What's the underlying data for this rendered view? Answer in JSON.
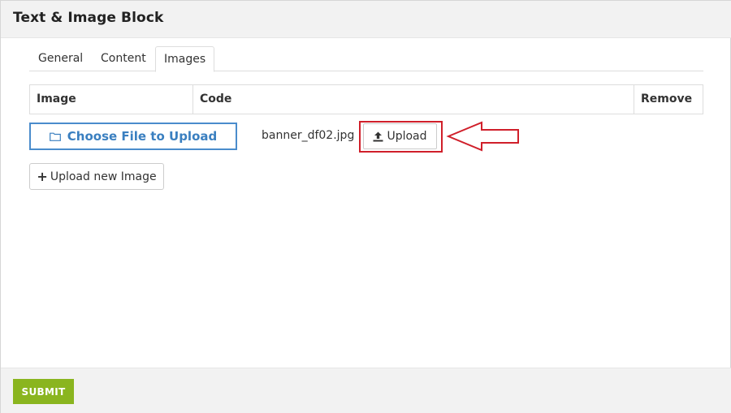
{
  "header": {
    "title": "Text & Image Block"
  },
  "tabs": [
    {
      "label": "General"
    },
    {
      "label": "Content"
    },
    {
      "label": "Images",
      "active": true
    }
  ],
  "table": {
    "columns": [
      "Image",
      "Code",
      "Remove"
    ]
  },
  "row": {
    "choose_label": "Choose File to Upload",
    "filename": "banner_df02.jpg",
    "upload_label": "Upload"
  },
  "add_image_label": "Upload new Image",
  "footer": {
    "submit_label": "SUBMIT"
  },
  "colors": {
    "accent_blue": "#3a7fc0",
    "highlight_red": "#d01f2a",
    "submit_green": "#8ab51f"
  },
  "icons": {
    "choose": "folder-icon",
    "upload": "upload-icon",
    "add": "plus-icon",
    "annotation": "arrow-left-icon"
  }
}
